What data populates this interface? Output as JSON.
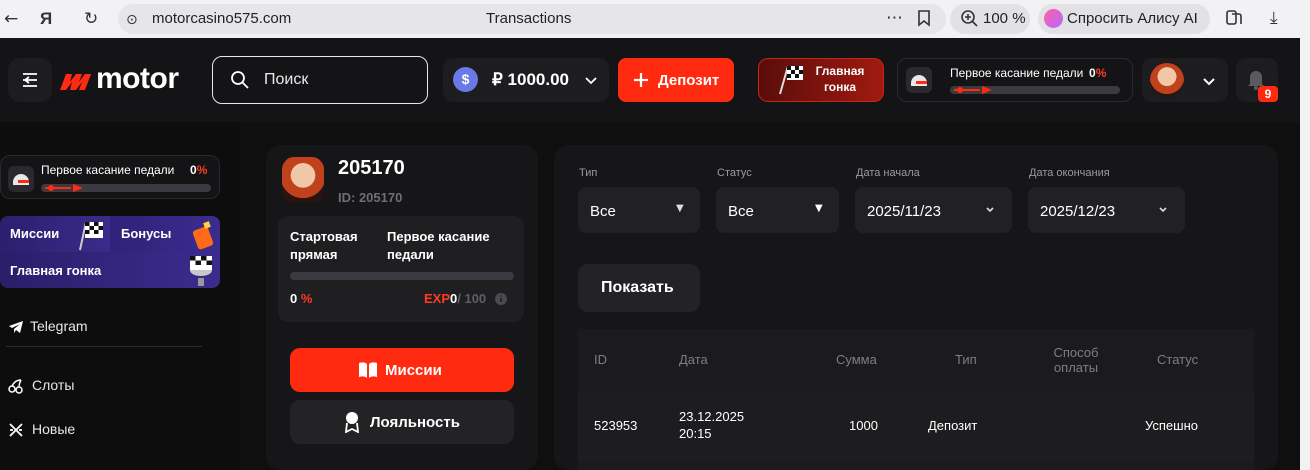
{
  "browser": {
    "back_icon": "arrow-left-icon",
    "url": "motorcasino575.com",
    "page_title": "Transactions",
    "zoom": "100 %",
    "alice": "Спросить Алису AI"
  },
  "header": {
    "logo": "motor",
    "search_placeholder": "Поиск",
    "balance": "₽ 1000.00",
    "coin_symbol": "$",
    "deposit_label": "Депозит",
    "race_label": "Главная гонка",
    "progress_label": "Первое касание педали",
    "progress_pct_value": "0",
    "progress_pct_sign": "%",
    "notifications_count": "9"
  },
  "sidebar": {
    "progress_label": "Первое касание педали",
    "progress_pct_value": "0",
    "progress_pct_sign": "%",
    "tiles": {
      "missions": "Миссии",
      "bonuses": "Бонусы",
      "main_race": "Главная гонка"
    },
    "items": [
      {
        "label": "Telegram",
        "icon": "telegram-icon"
      },
      {
        "label": "Слоты",
        "icon": "cherry-icon"
      },
      {
        "label": "Новые",
        "icon": "new-icon"
      }
    ]
  },
  "profile": {
    "id_title": "205170",
    "id_sub": "ID: 205170",
    "level_current": "Стартовая прямая",
    "level_next": "Первое касание педали",
    "level_pct_value": "0",
    "level_pct_sign": "%",
    "exp_label": "EXP",
    "exp_value": "0",
    "exp_max": "/ 100",
    "progress": 0,
    "missions_button": "Миссии",
    "loyalty_button": "Лояльность"
  },
  "filters": {
    "type": {
      "label": "Тип",
      "value": "Все"
    },
    "status": {
      "label": "Статус",
      "value": "Все"
    },
    "date_start": {
      "label": "Дата начала",
      "value": "2025/11/23"
    },
    "date_end": {
      "label": "Дата окончания",
      "value": "2025/12/23"
    },
    "show_button": "Показать"
  },
  "table": {
    "columns": [
      "ID",
      "Дата",
      "Сумма",
      "Тип",
      "Способ оплаты",
      "Статус"
    ],
    "rows": [
      {
        "id": "523953",
        "date": "23.12.2025",
        "time": "20:15",
        "amount": "1000",
        "type": "Депозит",
        "method": "",
        "status": "Успешно"
      }
    ]
  },
  "colors": {
    "accent": "#ff2a0f",
    "background": "#0f0f10",
    "panel": "#161618"
  }
}
